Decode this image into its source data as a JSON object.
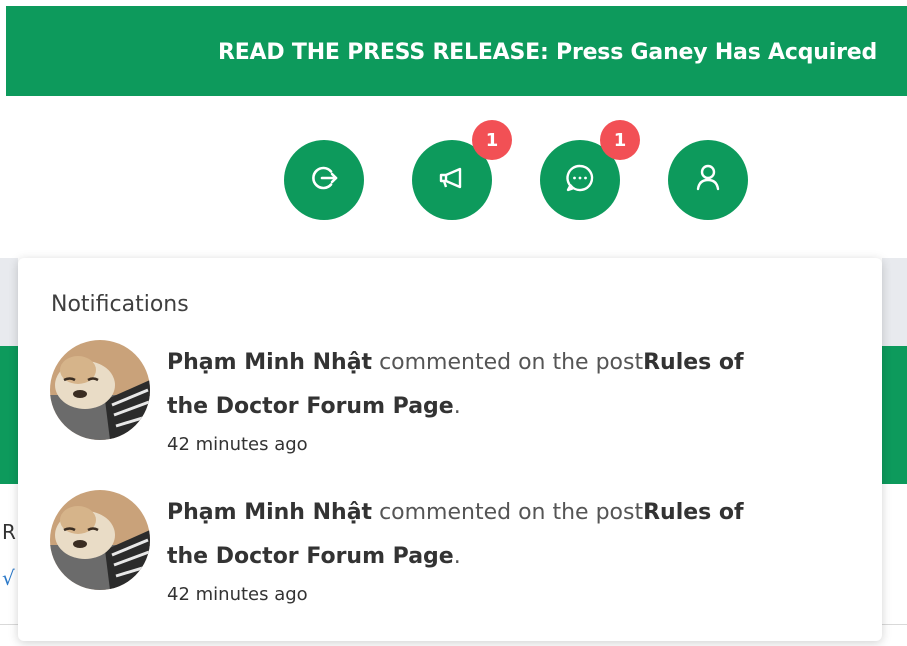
{
  "banner": {
    "text": "READ THE PRESS RELEASE: Press Ganey Has Acquired"
  },
  "toolbar": {
    "buttons": [
      {
        "name": "logout",
        "icon": "logout-arrow-icon"
      },
      {
        "name": "announcements",
        "icon": "megaphone-icon",
        "badge": "1"
      },
      {
        "name": "messages",
        "icon": "chat-bubble-icon",
        "badge": "1"
      },
      {
        "name": "profile",
        "icon": "user-icon"
      }
    ]
  },
  "background": {
    "left_text": "R",
    "left_check": "√"
  },
  "notifications": {
    "title": "Notifications",
    "items": [
      {
        "user": "Phạm Minh Nhật",
        "action": " commented on the post",
        "post_part1": "Rules of",
        "post_part2": "the Doctor Forum Page",
        "period": ".",
        "time": "42 minutes ago"
      },
      {
        "user": "Phạm Minh Nhật",
        "action": " commented on the post",
        "post_part1": "Rules of",
        "post_part2": "the Doctor Forum Page",
        "period": ".",
        "time": "42 minutes ago"
      }
    ]
  },
  "colors": {
    "brand_green": "#0d9a5c",
    "badge_red": "#f25055"
  }
}
